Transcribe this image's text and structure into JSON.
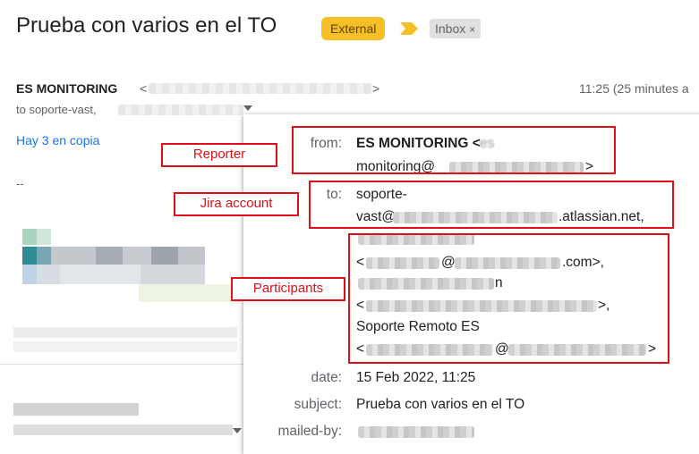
{
  "email": {
    "subject": "Prueba con varios en el TO",
    "labels": {
      "external": "External",
      "inbox": "Inbox",
      "inbox_remove": "×"
    },
    "sender_name": "ES MONITORING",
    "sender_bracket_open": "<",
    "sender_bracket_close": ">",
    "time": "11:25 (25 minutes a",
    "to_line": "to soporte-vast,",
    "cc_link": "Hay 3 en copia",
    "signature": "--"
  },
  "details": {
    "from_label": "from:",
    "from_name": "ES MONITORING <",
    "from_frag": "es",
    "from_line2_prefix": "monitoring@",
    "from_line2_suffix": ">",
    "to_label": "to:",
    "to_line1": "soporte-",
    "to_line2_prefix": "vast@",
    "to_line2_suffix": ".atlassian.net,",
    "p1_email_prefix": "<",
    "p1_email_mid": "@",
    "p1_email_suffix": ".com>,",
    "p2_tail": "n",
    "p2_email_prefix": "<",
    "p2_email_suffix": ">,",
    "p3_name": "Soporte Remoto ES",
    "p3_email_prefix": "<",
    "p3_email_mid": "@",
    "p3_email_suffix": ">",
    "date_label": "date:",
    "date": "15 Feb 2022, 11:25",
    "subject_label": "subject:",
    "subject": "Prueba con varios en el TO",
    "mailedby_label": "mailed-by:"
  },
  "annotations": {
    "reporter": "Reporter",
    "jira_account": "Jira account",
    "participants": "Participants"
  },
  "colors": {
    "accent_red": "#e0101a",
    "label_yellow": "#f6bf26",
    "link_blue": "#1a73e8"
  },
  "icons": [
    "label-arrow-icon",
    "chevron-down-icon",
    "close-icon"
  ]
}
